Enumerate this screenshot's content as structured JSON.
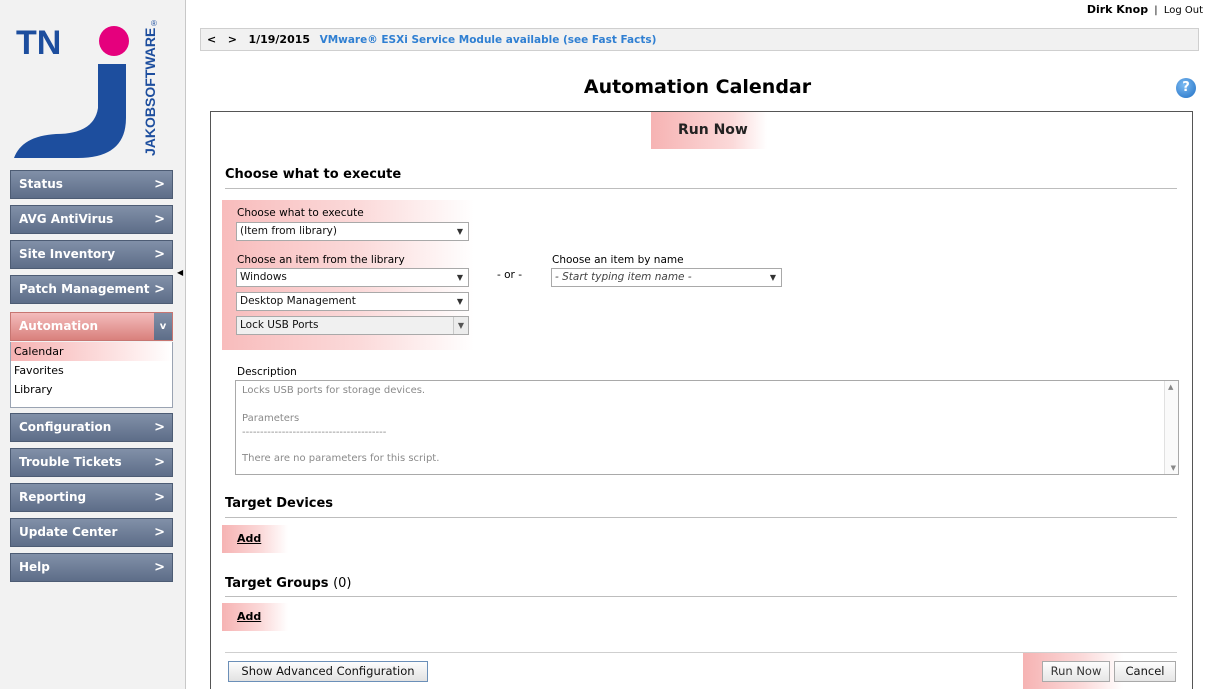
{
  "brand": {
    "logo_initials": "TN",
    "logo_vertical_text": "JAKOBSOFTWARE",
    "registered_mark": "®",
    "accent_color": "#e5007d",
    "logo_blue": "#1d4e9e"
  },
  "user": {
    "name": "Dirk Knop",
    "separator": "|",
    "logout_label": "Log Out"
  },
  "news": {
    "prev_icon": "<",
    "next_icon": ">",
    "date": "1/19/2015",
    "headline": "VMware® ESXi Service Module available (see Fast Facts)"
  },
  "nav": {
    "items": [
      {
        "label": "Status",
        "chevron": ">"
      },
      {
        "label": "AVG AntiVirus",
        "chevron": ">"
      },
      {
        "label": "Site Inventory",
        "chevron": ">"
      },
      {
        "label": "Patch Management",
        "chevron": ">"
      },
      {
        "label": "Automation",
        "chevron": "v",
        "active": true
      },
      {
        "label": "Configuration",
        "chevron": ">"
      },
      {
        "label": "Trouble Tickets",
        "chevron": ">"
      },
      {
        "label": "Reporting",
        "chevron": ">"
      },
      {
        "label": "Update Center",
        "chevron": ">"
      },
      {
        "label": "Help",
        "chevron": ">"
      }
    ],
    "automation_sub": [
      {
        "label": "Calendar",
        "selected": true
      },
      {
        "label": "Favorites"
      },
      {
        "label": "Library"
      }
    ]
  },
  "page": {
    "title": "Automation Calendar",
    "help_icon": "?",
    "run_now_tab": "Run Now"
  },
  "execute": {
    "section_title": "Choose what to execute",
    "what_label": "Choose what to execute",
    "what_value": "(Item from library)",
    "library_label": "Choose an item from the library",
    "library_os": "Windows",
    "library_category": "Desktop Management",
    "library_item": "Lock USB Ports",
    "or_label": "- or -",
    "by_name_label": "Choose an item by name",
    "by_name_placeholder": "- Start typing item name -"
  },
  "description": {
    "label": "Description",
    "lines": [
      "Locks USB ports for storage devices.",
      "",
      "Parameters",
      "----------------------------------------",
      "",
      "There are no parameters for this script."
    ]
  },
  "targets": {
    "devices_title": "Target Devices",
    "devices_add": "Add",
    "groups_title": "Target Groups",
    "groups_count": "(0)",
    "groups_add": "Add"
  },
  "footer": {
    "advanced_button": "Show Advanced Configuration",
    "run_button": "Run Now",
    "cancel_button": "Cancel"
  }
}
